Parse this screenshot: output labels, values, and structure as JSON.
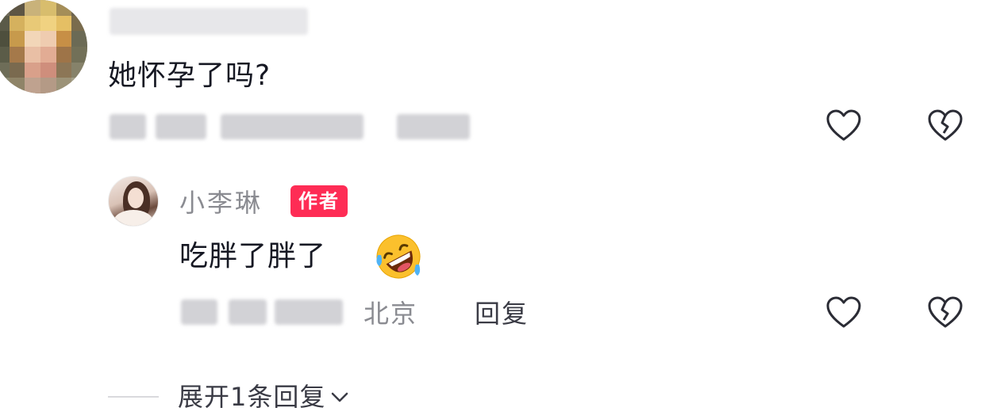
{
  "comment": {
    "text": "她怀孕了吗?",
    "reply_label": "回复"
  },
  "reply": {
    "username": "小李琳",
    "badge": "作者",
    "text": "吃胖了胖了",
    "emoji": "rolling-on-floor-laughing-emoji",
    "location": "北京",
    "reply_label": "回复"
  },
  "expand": {
    "label": "展开1条回复"
  },
  "icons": {
    "like": "heart-outline-icon",
    "dislike": "broken-heart-icon",
    "expand": "chevron-down-icon"
  },
  "colors": {
    "badge": "#fe2c55",
    "text": "#161823",
    "meta": "#8a8b91"
  }
}
